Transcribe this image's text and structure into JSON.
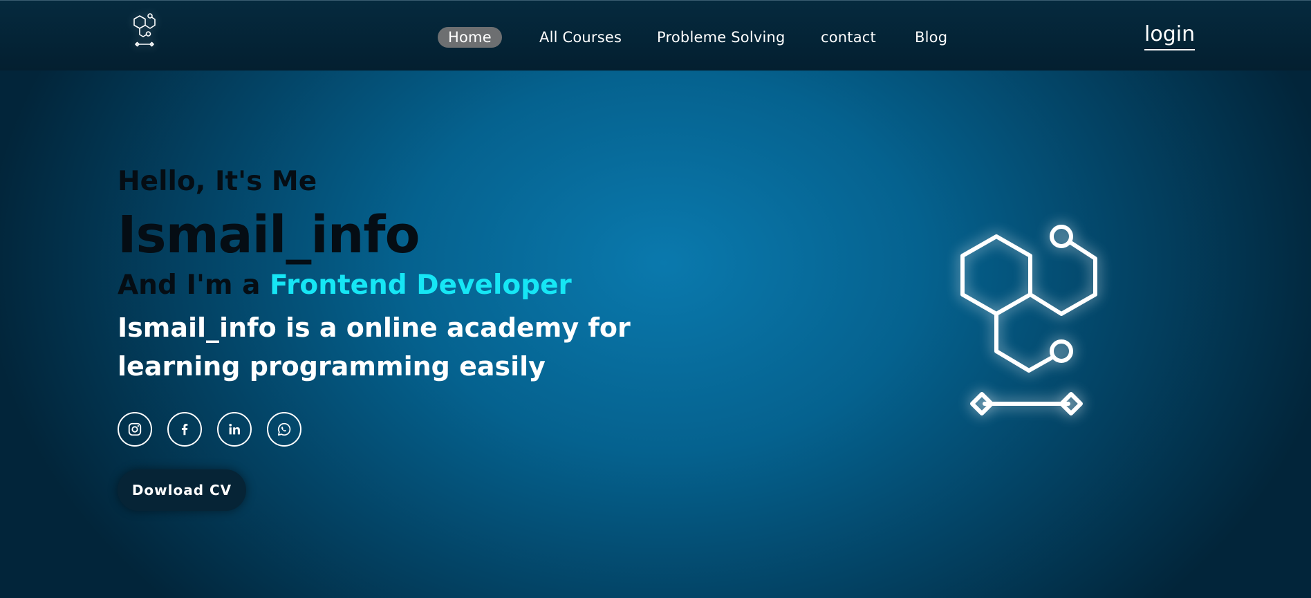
{
  "nav": {
    "logo_icon": "hexagon-circuit-logo-icon",
    "links": [
      {
        "label": "Home",
        "active": true
      },
      {
        "label": "All Courses",
        "active": false
      },
      {
        "label": "Probleme Solving",
        "active": false
      },
      {
        "label": "contact",
        "active": false
      },
      {
        "label": "Blog",
        "active": false
      }
    ],
    "login_label": "login"
  },
  "hero": {
    "greeting": "Hello, It's Me",
    "name": "Ismail_info",
    "role_prefix": "And I'm a",
    "role": "Frontend Developer",
    "description": "Ismail_info is a online academy for learning programming easily",
    "socials": [
      {
        "icon": "instagram-icon"
      },
      {
        "icon": "facebook-icon"
      },
      {
        "icon": "linkedin-icon"
      },
      {
        "icon": "whatsapp-icon"
      }
    ],
    "cv_button": "Dowload CV",
    "graphic_icon": "hexagon-circuit-illustration"
  },
  "colors": {
    "accent": "#16e6f5",
    "nav_bg": "#041f30",
    "active_pill": "#6d6f71",
    "button_bg": "#062436",
    "dark_text": "#050d14"
  }
}
